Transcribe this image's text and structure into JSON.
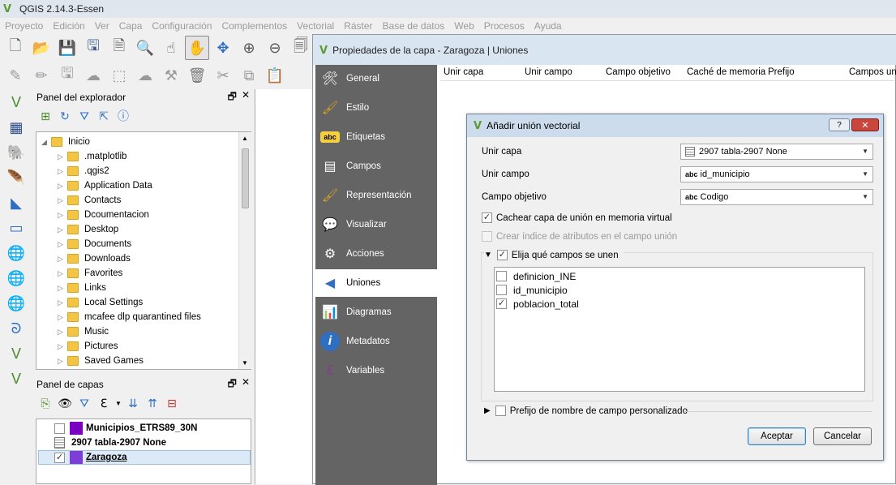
{
  "app": {
    "title": "QGIS 2.14.3-Essen"
  },
  "menu": [
    "Proyecto",
    "Edición",
    "Ver",
    "Capa",
    "Configuración",
    "Complementos",
    "Vectorial",
    "Ráster",
    "Base de datos",
    "Web",
    "Procesos",
    "Ayuda"
  ],
  "explorer": {
    "title": "Panel del explorador",
    "root": "Inicio",
    "items": [
      ".matplotlib",
      ".qgis2",
      "Application Data",
      "Contacts",
      "Dcoumentacion",
      "Desktop",
      "Documents",
      "Downloads",
      "Favorites",
      "Links",
      "Local Settings",
      "mcafee dlp quarantined files",
      "Music",
      "Pictures",
      "Saved Games"
    ]
  },
  "layers": {
    "title": "Panel de capas",
    "items": [
      {
        "name": "Municipios_ETRS89_30N",
        "checked": false,
        "color": "#7a00c2"
      },
      {
        "name": "2907 tabla-2907 None",
        "checked": null,
        "color": ""
      },
      {
        "name": "Zaragoza",
        "checked": true,
        "color": "#7b3fd6"
      }
    ]
  },
  "properties": {
    "title": "Propiedades de la capa - Zaragoza | Uniones",
    "sidebar": [
      "General",
      "Estilo",
      "Etiquetas",
      "Campos",
      "Representación",
      "Visualizar",
      "Acciones",
      "Uniones",
      "Diagramas",
      "Metadatos",
      "Variables"
    ],
    "selected": "Uniones",
    "columns": [
      "Unir capa",
      "Unir campo",
      "Campo objetivo",
      "Caché de memoria",
      "Prefijo",
      "Campos unid"
    ]
  },
  "dialog": {
    "title": "Añadir unión vectorial",
    "help_label": "?",
    "close_label": "✕",
    "join_layer_label": "Unir capa",
    "join_layer_value": "2907 tabla-2907 None",
    "join_field_label": "Unir campo",
    "join_field_prefix": "abc",
    "join_field_value": "id_municipio",
    "target_field_label": "Campo objetivo",
    "target_field_prefix": "abc",
    "target_field_value": "Codigo",
    "cache_label": "Cachear capa de unión en memoria virtual",
    "index_label": "Crear índice de atributos en el campo unión",
    "choose_fields_label": "Elija qué campos se unen",
    "fields": [
      {
        "name": "definicion_INE",
        "checked": false
      },
      {
        "name": "id_municipio",
        "checked": false
      },
      {
        "name": "poblacion_total",
        "checked": true
      }
    ],
    "prefix_label": "Prefijo de nombre de campo personalizado",
    "accept": "Aceptar",
    "cancel": "Cancelar"
  }
}
